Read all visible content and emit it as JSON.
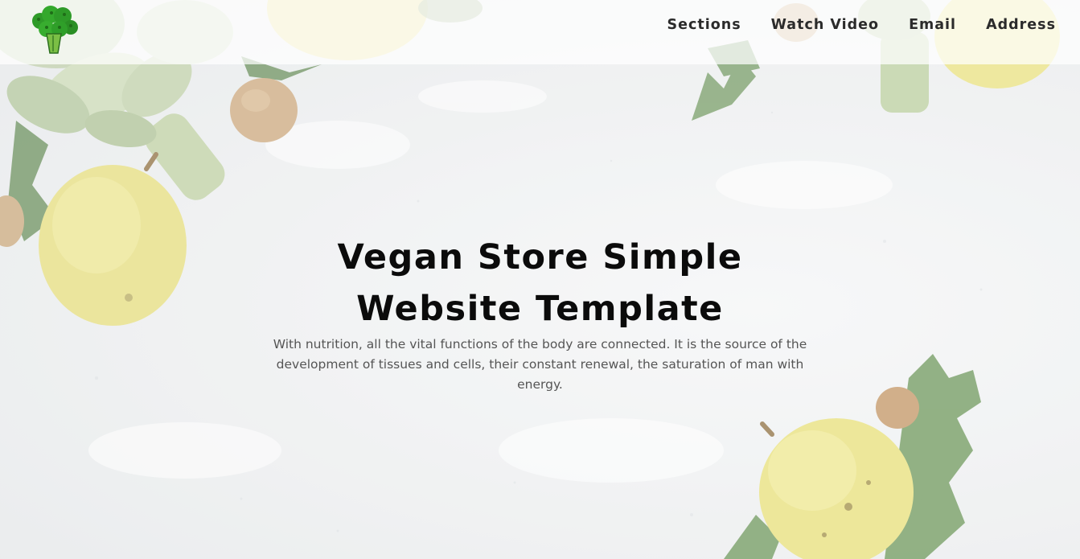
{
  "header": {
    "logo_icon": "broccoli-icon",
    "nav": [
      {
        "label": "Sections"
      },
      {
        "label": "Watch Video"
      },
      {
        "label": "Email"
      },
      {
        "label": "Address"
      }
    ]
  },
  "hero": {
    "title": "Vegan Store Simple Website Template",
    "description": "With nutrition, all the vital functions of the body are connected. It is the source of the development of tissues and cells, their constant renewal, the saturation of man with energy."
  },
  "colors": {
    "background": "#e9ebec",
    "title": "#0b0b0b",
    "nav_text": "#2b2b2b",
    "body_text": "#555555",
    "pear": "#e6e07a",
    "leaf": "#4e7a3c",
    "logo_green": "#2e9a28"
  }
}
